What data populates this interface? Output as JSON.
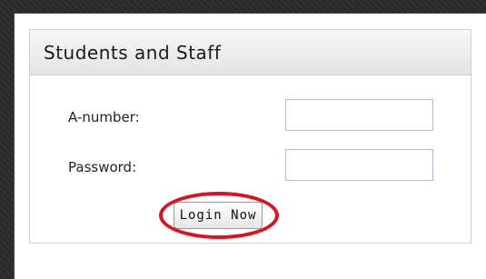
{
  "login_panel": {
    "title": "Students and Staff",
    "anumber_label": "A-number:",
    "anumber_value": "",
    "password_label": "Password:",
    "password_value": "",
    "login_button_label": "Login Now"
  },
  "colors": {
    "highlight_ring": "#e0101e",
    "input_border": "#b9b9ec",
    "panel_border": "#d2d2d2",
    "background": "#2b2b2b"
  }
}
